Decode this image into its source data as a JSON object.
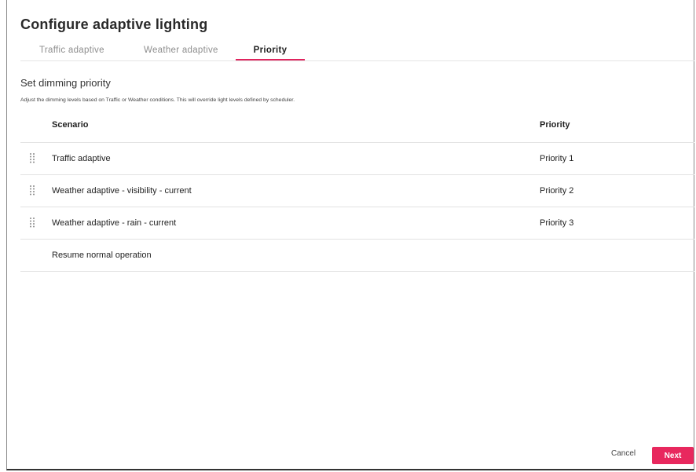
{
  "dialog": {
    "title": "Configure adaptive lighting"
  },
  "tabs": [
    {
      "label": "Traffic adaptive",
      "active": false
    },
    {
      "label": "Weather adaptive",
      "active": false
    },
    {
      "label": "Priority",
      "active": true
    }
  ],
  "section": {
    "title": "Set dimming priority",
    "description": "Adjust the dimming levels based on Traffic or Weather conditions. This will override light levels defined by scheduler."
  },
  "table": {
    "headers": {
      "scenario": "Scenario",
      "priority": "Priority"
    },
    "rows": [
      {
        "scenario": "Traffic adaptive",
        "priority": "Priority 1",
        "draggable": true
      },
      {
        "scenario": "Weather adaptive - visibility - current",
        "priority": "Priority 2",
        "draggable": true
      },
      {
        "scenario": "Weather adaptive - rain - current",
        "priority": "Priority 3",
        "draggable": true
      },
      {
        "scenario": "Resume normal operation",
        "priority": "",
        "draggable": false
      }
    ]
  },
  "footer": {
    "cancel_label": "Cancel",
    "next_label": "Next"
  },
  "colors": {
    "accent": "#e8285e",
    "active_tab_underline": "#e0245e"
  },
  "icons": {
    "drag_handle": "drag-handle-icon"
  }
}
